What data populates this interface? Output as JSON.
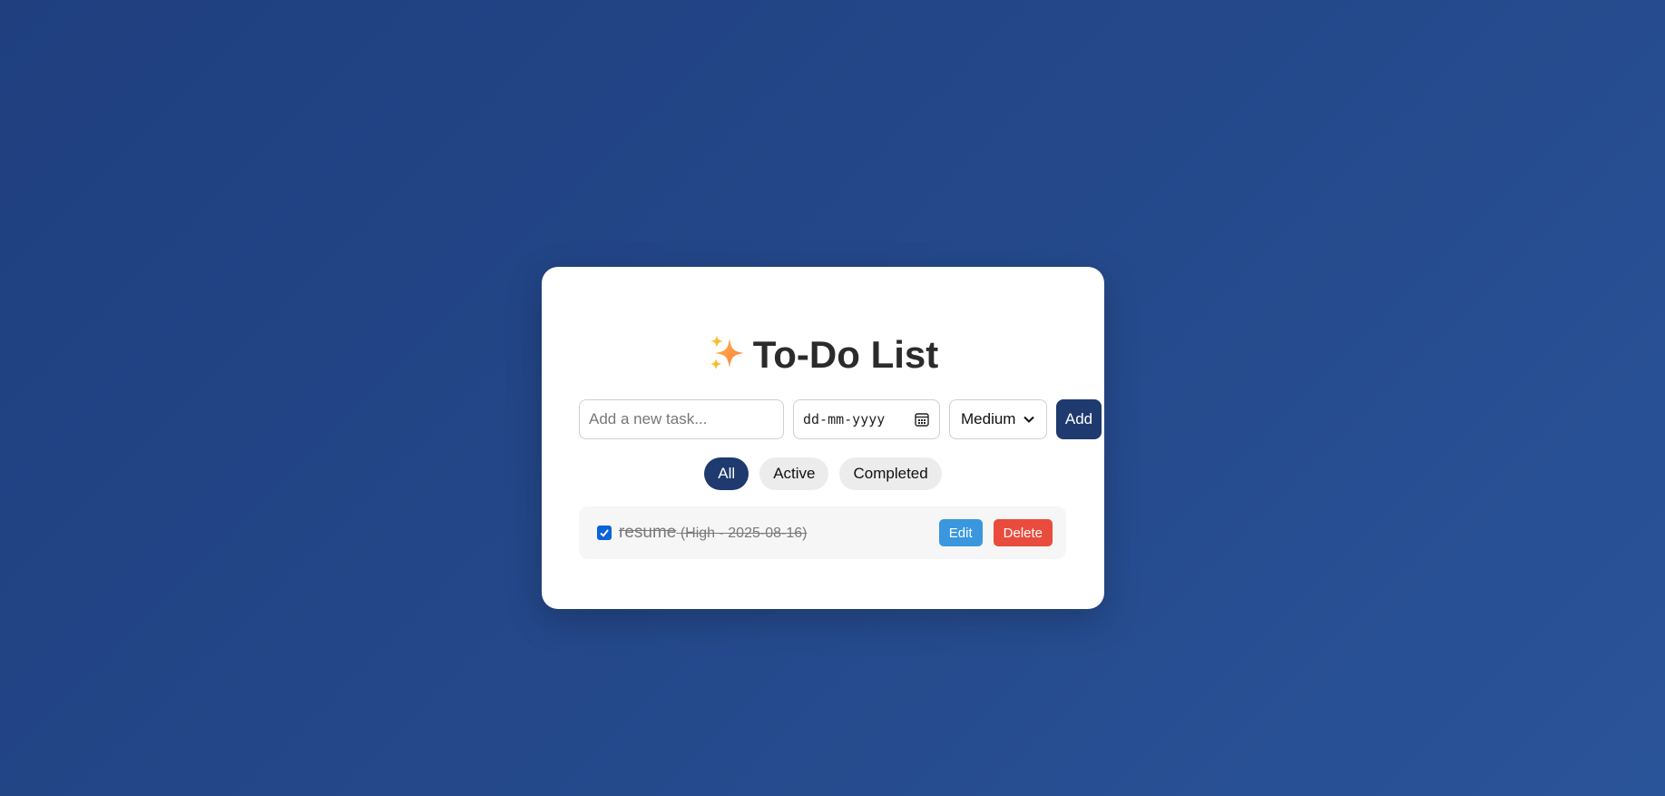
{
  "app": {
    "title": "To-Do List",
    "title_icon": "sparkles-icon"
  },
  "form": {
    "task_placeholder": "Add a new task...",
    "task_value": "",
    "date_placeholder": "dd-mm-yyyy",
    "priority_selected": "Medium",
    "add_label": "Add"
  },
  "filters": [
    {
      "label": "All",
      "active": true
    },
    {
      "label": "Active",
      "active": false
    },
    {
      "label": "Completed",
      "active": false
    }
  ],
  "tasks": [
    {
      "name": "resume",
      "meta": "(High - 2025-08-16)",
      "completed": true,
      "edit_label": "Edit",
      "delete_label": "Delete"
    }
  ],
  "colors": {
    "primary": "#1e3a6e",
    "edit": "#3a97dd",
    "delete": "#e94c3d",
    "checkbox": "#0a63d8"
  }
}
